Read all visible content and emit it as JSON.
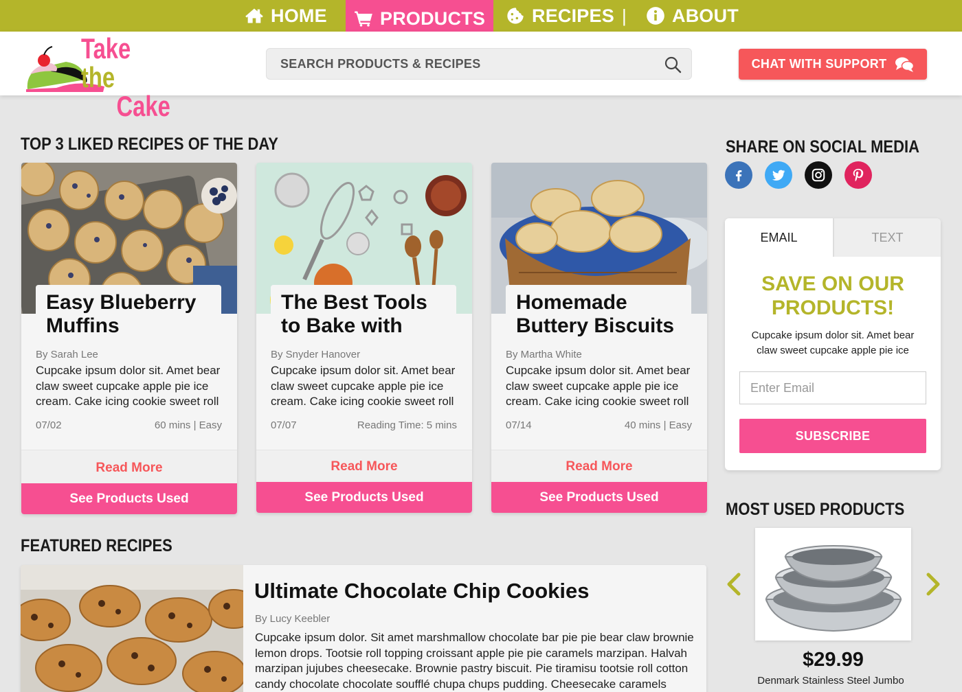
{
  "nav": {
    "items": [
      {
        "label": "HOME",
        "icon": "home-icon"
      },
      {
        "label": "PRODUCTS",
        "icon": "cart-icon",
        "active": true
      },
      {
        "label": "RECIPES",
        "icon": "cookie-icon"
      },
      {
        "label": "ABOUT",
        "icon": "info-icon"
      }
    ],
    "separator": "|"
  },
  "header": {
    "logo_line1": "Take",
    "logo_the": "the",
    "logo_line2": "Cake",
    "search_placeholder": "SEARCH PRODUCTS & RECIPES",
    "chat_label": "CHAT WITH SUPPORT"
  },
  "top_recipes": {
    "title": "TOP 3 LIKED RECIPES OF THE DAY",
    "cards": [
      {
        "title": "Easy Blueberry Muffins",
        "author": "By Sarah Lee",
        "description": "Cupcake ipsum dolor sit. Amet bear claw sweet cupcake apple pie ice cream. Cake icing cookie sweet roll",
        "date": "07/02",
        "info": "60 mins  | Easy",
        "read_more": "Read More",
        "products_label": "See Products Used"
      },
      {
        "title": "The Best Tools to Bake with",
        "author": "By Snyder Hanover",
        "description": "Cupcake ipsum dolor sit. Amet bear claw sweet cupcake apple pie ice cream. Cake icing cookie sweet roll",
        "date": "07/07",
        "info": "Reading Time: 5 mins",
        "read_more": "Read More",
        "products_label": "See Products Used"
      },
      {
        "title": "Homemade Buttery Biscuits",
        "author": "By Martha White",
        "description": "Cupcake ipsum dolor sit. Amet bear claw sweet cupcake apple pie ice cream. Cake icing cookie sweet roll",
        "date": "07/14",
        "info": "40 mins  | Easy",
        "read_more": "Read More",
        "products_label": "See Products Used"
      }
    ]
  },
  "featured": {
    "title": "FEATURED RECIPES",
    "recipe_title": "Ultimate Chocolate Chip Cookies",
    "author": "By Lucy Keebler",
    "description": "Cupcake ipsum dolor. Sit amet marshmallow chocolate bar pie pie bear claw brownie lemon drops. Tootsie roll topping croissant apple pie pie caramels marzipan. Halvah marzipan jujubes cheesecake. Brownie pastry biscuit. Pie tiramisu tootsie roll cotton candy chocolate chocolate soufflé chupa chups pudding. Cheesecake caramels"
  },
  "social": {
    "title": "SHARE ON SOCIAL MEDIA",
    "items": [
      {
        "icon": "facebook-icon",
        "color": "#3b73b9"
      },
      {
        "icon": "twitter-icon",
        "color": "#3fa9f5"
      },
      {
        "icon": "instagram-icon",
        "color": "#111111"
      },
      {
        "icon": "pinterest-icon",
        "color": "#e0245e"
      }
    ]
  },
  "signup": {
    "tab_email": "EMAIL",
    "tab_text": "TEXT",
    "title": "SAVE ON OUR PRODUCTS!",
    "description": "Cupcake ipsum dolor sit. Amet bear claw sweet cupcake apple pie ice",
    "email_placeholder": "Enter Email",
    "subscribe_label": "SUBSCRIBE"
  },
  "most_used": {
    "title": "MOST USED PRODUCTS",
    "price": "$29.99",
    "product_name": "Denmark Stainless Steel Jumbo"
  },
  "colors": {
    "olive": "#b4b52a",
    "pink": "#f64f91",
    "coral": "#f6575a"
  }
}
